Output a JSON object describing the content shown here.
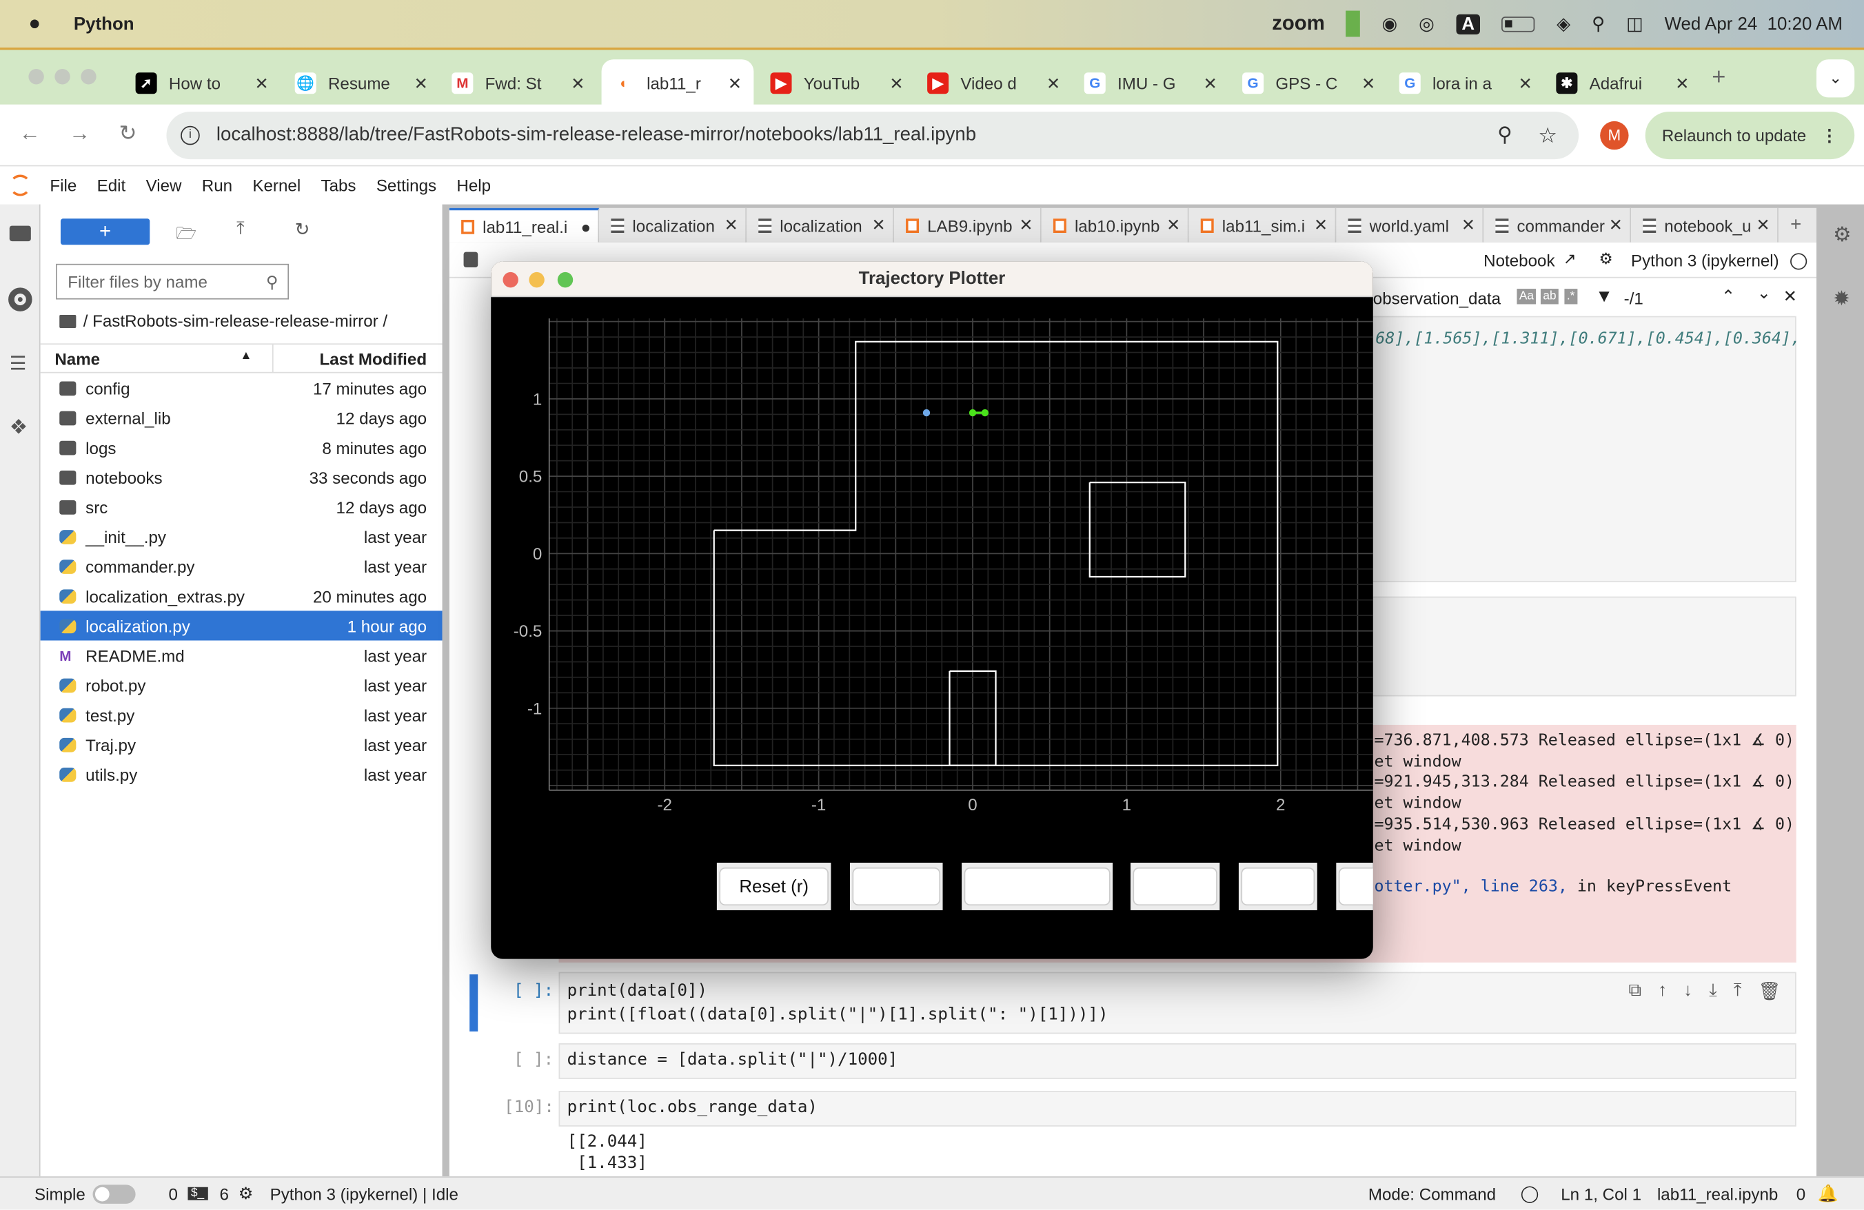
{
  "mac_menubar": {
    "app_name": "Python",
    "status_items": [
      "zoom"
    ],
    "datetime": "Wed Apr 24  10:20 AM",
    "icons": [
      "apple-icon",
      "green-app-icon",
      "wechat-icon",
      "airdrop-icon",
      "input-source-icon",
      "battery-icon",
      "wifi-icon",
      "spotlight-icon",
      "control-center-icon"
    ],
    "input_source": "A"
  },
  "browser": {
    "tabs": [
      {
        "label": "How to",
        "icon": "arrow-logo-icon",
        "active": false
      },
      {
        "label": "Resume",
        "icon": "globe-icon",
        "active": false
      },
      {
        "label": "Fwd: St",
        "icon": "gmail-icon",
        "active": false
      },
      {
        "label": "lab11_r",
        "icon": "jupyter-icon",
        "active": true
      },
      {
        "label": "YouTub",
        "icon": "youtube-icon",
        "active": false
      },
      {
        "label": "Video d",
        "icon": "youtube-icon",
        "active": false
      },
      {
        "label": "IMU - G",
        "icon": "google-icon",
        "active": false
      },
      {
        "label": "GPS - C",
        "icon": "google-icon",
        "active": false
      },
      {
        "label": "lora in a",
        "icon": "google-icon",
        "active": false
      },
      {
        "label": "Adafrui",
        "icon": "adafruit-icon",
        "active": false
      }
    ],
    "url": "localhost:8888/lab/tree/FastRobots-sim-release-release-mirror/notebooks/lab11_real.ipynb",
    "profile_initial": "M",
    "relaunch_label": "Relaunch to update"
  },
  "jupyter": {
    "menu": [
      "File",
      "Edit",
      "View",
      "Run",
      "Kernel",
      "Tabs",
      "Settings",
      "Help"
    ],
    "filebrowser": {
      "new_label": "+",
      "filter_placeholder": "Filter files by name",
      "breadcrumb": "/ FastRobots-sim-release-release-mirror /",
      "col_name": "Name",
      "col_modified": "Last Modified",
      "items": [
        {
          "name": "config",
          "modified": "17 minutes ago",
          "type": "folder"
        },
        {
          "name": "external_lib",
          "modified": "12 days ago",
          "type": "folder"
        },
        {
          "name": "logs",
          "modified": "8 minutes ago",
          "type": "folder"
        },
        {
          "name": "notebooks",
          "modified": "33 seconds ago",
          "type": "folder"
        },
        {
          "name": "src",
          "modified": "12 days ago",
          "type": "folder"
        },
        {
          "name": "__init__.py",
          "modified": "last year",
          "type": "python"
        },
        {
          "name": "commander.py",
          "modified": "last year",
          "type": "python"
        },
        {
          "name": "localization_extras.py",
          "modified": "20 minutes ago",
          "type": "python"
        },
        {
          "name": "localization.py",
          "modified": "1 hour ago",
          "type": "python",
          "selected": true
        },
        {
          "name": "README.md",
          "modified": "last year",
          "type": "markdown"
        },
        {
          "name": "robot.py",
          "modified": "last year",
          "type": "python"
        },
        {
          "name": "test.py",
          "modified": "last year",
          "type": "python"
        },
        {
          "name": "Traj.py",
          "modified": "last year",
          "type": "python"
        },
        {
          "name": "utils.py",
          "modified": "last year",
          "type": "python"
        }
      ]
    },
    "tabs": [
      {
        "label": "lab11_real.i",
        "type": "notebook",
        "active": true
      },
      {
        "label": "localization",
        "type": "text"
      },
      {
        "label": "localization",
        "type": "text"
      },
      {
        "label": "LAB9.ipynb",
        "type": "notebook"
      },
      {
        "label": "lab10.ipynb",
        "type": "notebook"
      },
      {
        "label": "lab11_sim.i",
        "type": "notebook"
      },
      {
        "label": "world.yaml",
        "type": "text"
      },
      {
        "label": "commander",
        "type": "text"
      },
      {
        "label": "notebook_u",
        "type": "text"
      }
    ],
    "toolbar": {
      "cell_type": "Code",
      "notebook_label": "Notebook",
      "kernel_label": "Python 3 (ipykernel)"
    },
    "find": {
      "query": "observation_data",
      "count": "-/1"
    },
    "output_top": "68],[1.565],[1.311],[0.671],[0.454],[0.364],",
    "error_lines": [
      "=736.871,408.573 Released ellipse=(1x1 ∡ 0)",
      "et window",
      "=921.945,313.284 Released ellipse=(1x1 ∡ 0)",
      "et window",
      "=935.514,530.963 Released ellipse=(1x1 ∡ 0)",
      "et window"
    ],
    "traceback": {
      "file": "otter.py\",",
      "line": "line 263,",
      "rest": "in keyPressEvent"
    },
    "cells": [
      {
        "prompt": "[ ]:",
        "lines": [
          "print(data[0])",
          "print([float((data[0].split(\"|\")[1].split(\": \")[1]))])"
        ]
      },
      {
        "prompt": "[ ]:",
        "lines": [
          "distance = [data.split(\"|\")/1000]"
        ]
      },
      {
        "prompt": "[10]:",
        "lines": [
          "print(loc.obs_range_data)"
        ],
        "output": [
          "[[2.044]",
          " [1.433]"
        ]
      }
    ],
    "status": {
      "mode_label": "Simple",
      "terminals": "0",
      "kernels": "6",
      "kernel_status": "Python 3 (ipykernel) | Idle",
      "mode": "Mode: Command",
      "cursor": "Ln 1, Col 1",
      "file": "lab11_real.ipynb",
      "notifications": "0"
    }
  },
  "plotter": {
    "title": "Trajectory Plotter",
    "buttons": [
      "Reset (r)",
      "",
      "",
      "",
      "",
      ""
    ],
    "chart_data": {
      "type": "scatter",
      "xlim": [
        -2.75,
        2.6
      ],
      "ylim": [
        -1.53,
        1.52
      ],
      "xticks": [
        -2,
        -1,
        0,
        1,
        2
      ],
      "yticks": [
        1,
        0.5,
        0,
        -0.5,
        -1
      ],
      "grid": true,
      "background": "#000000",
      "walls": [
        {
          "name": "outer",
          "points": [
            [
              -1.68,
              0.15
            ],
            [
              -0.76,
              0.15
            ],
            [
              -0.76,
              1.37
            ],
            [
              1.98,
              1.37
            ],
            [
              1.98,
              -1.37
            ],
            [
              -1.68,
              -1.37
            ],
            [
              -1.68,
              0.15
            ]
          ]
        },
        {
          "name": "box",
          "points": [
            [
              0.76,
              0.46
            ],
            [
              1.38,
              0.46
            ],
            [
              1.38,
              -0.15
            ],
            [
              0.76,
              -0.15
            ],
            [
              0.76,
              0.46
            ]
          ]
        },
        {
          "name": "small_box",
          "points": [
            [
              -0.15,
              -0.76
            ],
            [
              0.15,
              -0.76
            ],
            [
              0.15,
              -1.37
            ],
            [
              -0.15,
              -1.37
            ],
            [
              -0.15,
              -0.76
            ]
          ]
        }
      ],
      "series": [
        {
          "color": "#6ea8e8",
          "points": [
            [
              -0.3,
              0.91
            ]
          ]
        },
        {
          "color": "#4be31c",
          "points": [
            [
              0.0,
              0.91
            ],
            [
              0.08,
              0.91
            ]
          ],
          "connected": true
        }
      ]
    }
  }
}
